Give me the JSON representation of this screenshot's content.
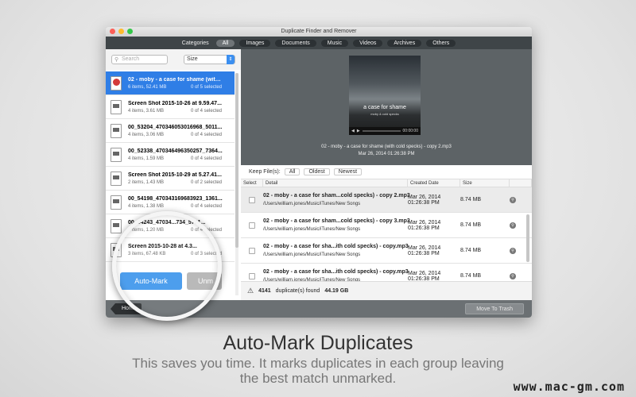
{
  "window": {
    "title": "Duplicate Finder and Remover"
  },
  "categories": {
    "label": "Categories",
    "tabs": [
      "All",
      "Images",
      "Documents",
      "Music",
      "Videos",
      "Archives",
      "Others"
    ],
    "active": "All"
  },
  "sidebar": {
    "search_placeholder": "Search",
    "sort_value": "Size",
    "groups": [
      {
        "name": "02 - moby - a case for shame (with c...",
        "info": "6 items, 52.41 MB",
        "selected": "0 of 5 selected",
        "icon": "music-file-icon"
      },
      {
        "name": "Screen Shot 2015-10-26 at 9.59.47...",
        "info": "4 items, 3.61 MB",
        "selected": "0 of 4 selected",
        "icon": "image-file-icon"
      },
      {
        "name": "00_53204_470346053016968_5011...",
        "info": "4 items, 3.06 MB",
        "selected": "0 of 4 selected",
        "icon": "image-file-icon"
      },
      {
        "name": "00_52338_470346496350257_7364...",
        "info": "4 items, 1.59 MB",
        "selected": "0 of 4 selected",
        "icon": "image-file-icon"
      },
      {
        "name": "Screen Shot 2015-10-29 at 5.27.41...",
        "info": "2 items, 1.43 MB",
        "selected": "0 of 2 selected",
        "icon": "image-file-icon"
      },
      {
        "name": "00_54198_470343169683923_1361...",
        "info": "4 items, 1.38 MB",
        "selected": "0 of 4 selected",
        "icon": "image-file-icon"
      },
      {
        "name": "00_54243_47034...734_5781...",
        "info": "4 items, 1.20 MB",
        "selected": "0 of 4 selected",
        "icon": "image-file-icon"
      },
      {
        "name": "Screen 2015-10-28 at 4.3...",
        "info": "3 items, 67.48 KB",
        "selected": "0 of 3 selected",
        "icon": "image-file-icon"
      }
    ],
    "auto_mark_label": "Auto-Mark",
    "unmark_label": "Unm"
  },
  "preview": {
    "album_title": "a case for shame",
    "album_sub": "moby & cold specks",
    "time": "00:00:00",
    "filename": "02 - moby - a case for shame (with cold specks) - copy 2.mp3",
    "date": "Mar 26, 2014 01:26:38 PM"
  },
  "keep": {
    "label": "Keep File(s):",
    "options": [
      "All",
      "Oldest",
      "Newest"
    ]
  },
  "table": {
    "headers": [
      "Select",
      "Detail",
      "Created Date",
      "Size"
    ],
    "rows": [
      {
        "name": "02 - moby - a case for sham...cold specks) - copy 2.mp3",
        "path": "/Users/william.jones/Music/iTunes/New Songs",
        "date": "Mar 26, 2014 01:26:38 PM",
        "size": "8.74 MB"
      },
      {
        "name": "02 - moby - a case for sham...cold specks) - copy 3.mp3",
        "path": "/Users/william.jones/Music/iTunes/New Songs",
        "date": "Mar 26, 2014 01:26:38 PM",
        "size": "8.74 MB"
      },
      {
        "name": "02 - moby - a case for sha...ith cold specks) - copy.mp3",
        "path": "/Users/william.jones/Music/iTunes/New Songs",
        "date": "Mar 26, 2014 01:26:38 PM",
        "size": "8.74 MB"
      },
      {
        "name": "02 - moby - a case for sha...ith cold specks) - copy.mp3",
        "path": "/Users/william.jones/Music/iTunes/New Songs",
        "date": "Mar 26, 2014 01:26:38 PM",
        "size": "8.74 MB"
      }
    ]
  },
  "status": {
    "count": "4141",
    "text": "duplicate(s) found",
    "size": "44.19 GB"
  },
  "bottom": {
    "home": "Home",
    "trash": "Move To Trash"
  },
  "caption": {
    "headline": "Auto-Mark Duplicates",
    "line1": "This saves you time. It marks duplicates in each group leaving",
    "line2": "the best match unmarked."
  },
  "watermark": "www.mac-gm.com"
}
